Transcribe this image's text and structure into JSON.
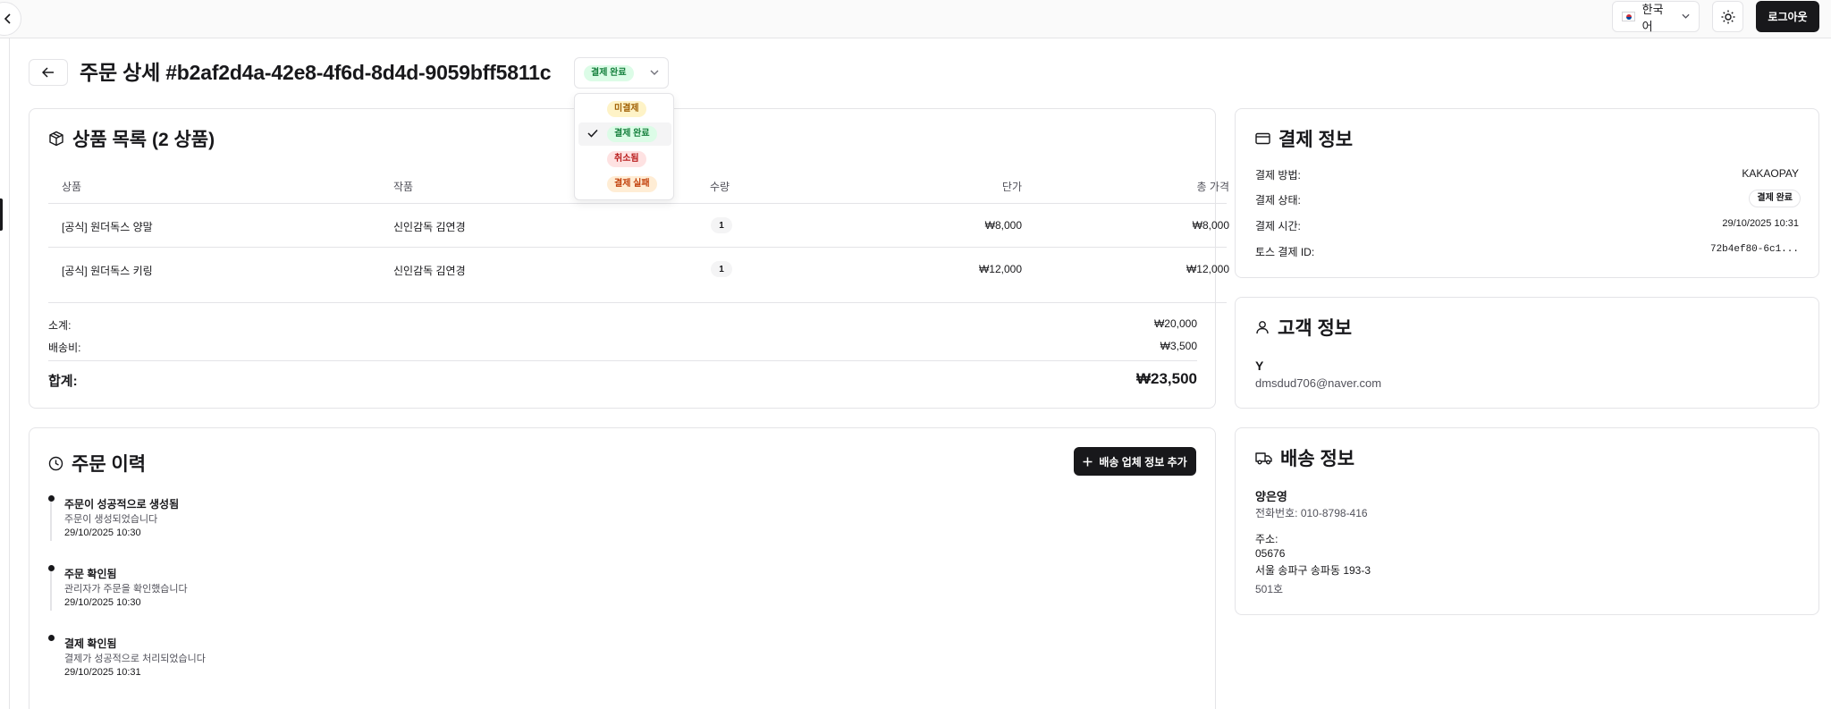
{
  "header": {
    "language_label": "한국어",
    "logout_label": "로그아웃",
    "page_title": "주문 상세 #b2af2d4a-42e8-4f6d-8d4d-9059bff5811c",
    "status_selected": "결제 완료"
  },
  "status_dropdown": {
    "options": [
      {
        "label": "미결제",
        "color": "#fef3c7",
        "checked": false
      },
      {
        "label": "결제 완료",
        "color": "#dcfce7",
        "checked": true
      },
      {
        "label": "취소됨",
        "color": "#fee2e2",
        "checked": false
      },
      {
        "label": "결제 실패",
        "color": "#ffedd5",
        "checked": false
      }
    ]
  },
  "products": {
    "title": "상품 목록 (2 상품)",
    "columns": [
      "상품",
      "작품",
      "수량",
      "단가",
      "총 가격"
    ],
    "rows": [
      {
        "product": "[공식] 원더독스 양말",
        "work": "신인감독 김연경",
        "qty": "1",
        "unit_price": "₩8,000",
        "total": "₩8,000"
      },
      {
        "product": "[공식] 원더독스 키링",
        "work": "신인감독 김연경",
        "qty": "1",
        "unit_price": "₩12,000",
        "total": "₩12,000"
      }
    ],
    "subtotal_label": "소계:",
    "subtotal_value": "₩20,000",
    "shipping_label": "배송비:",
    "shipping_value": "₩3,500",
    "total_label": "합계:",
    "total_value": "₩23,500"
  },
  "payment": {
    "title": "결제 정보",
    "method_label": "결제 방법:",
    "method_value": "KAKAOPAY",
    "status_label": "결제 상태:",
    "status_value": "결제 완료",
    "time_label": "결제 시간:",
    "time_value": "29/10/2025 10:31",
    "toss_id_label": "토스 결제 ID:",
    "toss_id_value": "72b4ef80-6c1..."
  },
  "customer": {
    "title": "고객 정보",
    "name": "Y",
    "email": "dmsdud706@naver.com"
  },
  "shipping": {
    "title": "배송 정보",
    "recipient": "양은영",
    "phone": "전화번호: 010-8798-416",
    "address_label": "주소:",
    "postal_code": "05676",
    "address_line1": "서울 송파구 송파동 193-3",
    "address_line2": "501호"
  },
  "history": {
    "title": "주문 이력",
    "add_shipping_label": "배송 업체 정보 추가",
    "events": [
      {
        "title": "주문이 성공적으로 생성됨",
        "desc": "주문이 생성되었습니다",
        "time": "29/10/2025 10:30"
      },
      {
        "title": "주문 확인됨",
        "desc": "관리자가 주문을 확인했습니다",
        "time": "29/10/2025 10:30"
      },
      {
        "title": "결제 확인됨",
        "desc": "결제가 성공적으로 처리되었습니다",
        "time": "29/10/2025 10:31"
      }
    ]
  }
}
